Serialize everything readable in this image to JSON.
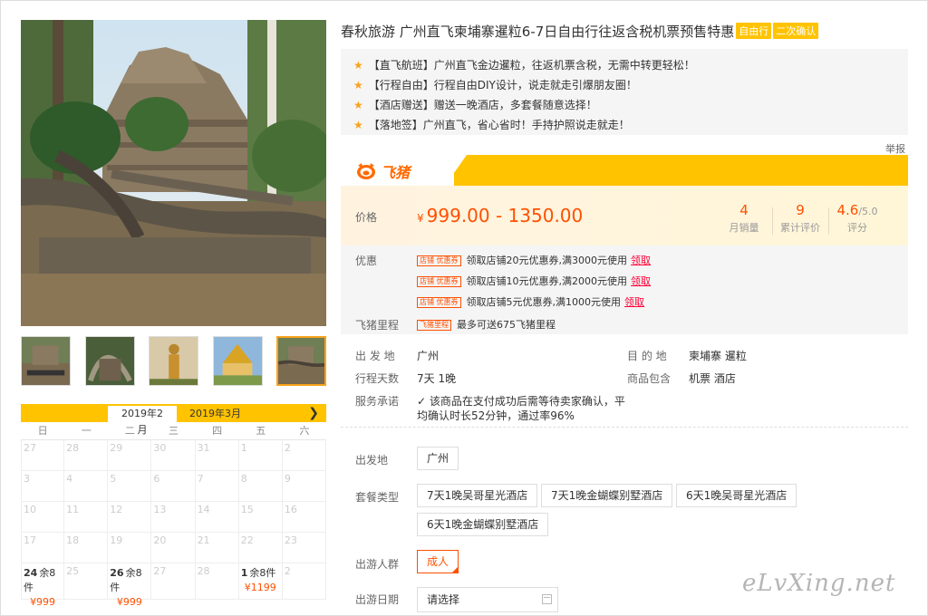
{
  "product": {
    "title": "春秋旅游 广州直飞柬埔寨暹粒6-7日自由行往返含税机票预售特惠",
    "tags": [
      "自由行",
      "二次确认"
    ]
  },
  "features": [
    "【直飞航班】广州直飞金边暹粒，往返机票含税，无需中转更轻松！",
    "【行程自由】行程自由DIY设计，说走就走引爆朋友圈！",
    "【酒店赠送】赠送一晚酒店，多套餐随意选择！",
    "【落地签】广州直飞，省心省时！手持护照说走就走！"
  ],
  "report_label": "举报",
  "brand": {
    "name": "飞猪",
    "color": "#ff6a00",
    "bar_color": "#ffc300"
  },
  "price": {
    "label": "价格",
    "currency": "¥",
    "range": "999.00 - 1350.00",
    "stats": [
      {
        "value": "4",
        "label": "月销量"
      },
      {
        "value": "9",
        "label": "累计评价"
      },
      {
        "value": "4.6",
        "suffix": "/5.0",
        "label": "评分"
      }
    ]
  },
  "promotions": {
    "label": "优惠",
    "badge": "店铺 优惠券",
    "take_label": "领取",
    "coupons": [
      "领取店铺20元优惠券,满3000元使用",
      "领取店铺10元优惠券,满2000元使用",
      "领取店铺5元优惠券,满1000元使用"
    ],
    "miles_label": "飞猪里程",
    "miles_badge": "飞猪里程",
    "miles_text": "最多可送675飞猪里程"
  },
  "info": {
    "origin_label": "出 发 地",
    "origin": "广州",
    "destination_label": "目 的 地",
    "destination": "柬埔寨  暹粒",
    "duration_label": "行程天数",
    "duration": "7天  1晚",
    "includes_label": "商品包含",
    "includes": "机票  酒店",
    "service_label": "服务承诺",
    "service_line1": "该商品在支付成功后需等待卖家确认，平",
    "service_line2": "均确认时长52分钟，通过率96%"
  },
  "options": {
    "departure_label": "出发地",
    "departure_value": "广州",
    "package_label": "套餐类型",
    "packages": [
      "7天1晚吴哥星光酒店",
      "7天1晚金蝴蝶别墅酒店",
      "6天1晚吴哥星光酒店",
      "6天1晚金蝴蝶别墅酒店"
    ],
    "traveler_label": "出游人群",
    "traveler_value": "成人",
    "date_label": "出游日期",
    "date_placeholder": "请选择"
  },
  "calendar": {
    "months": [
      "2019年2月",
      "2019年3月"
    ],
    "weekdays": [
      "日",
      "一",
      "二",
      "三",
      "四",
      "五",
      "六"
    ],
    "rows": [
      [
        "27",
        "28",
        "29",
        "30",
        "31",
        "1",
        "2"
      ],
      [
        "3",
        "4",
        "5",
        "6",
        "7",
        "8",
        "9"
      ],
      [
        "10",
        "11",
        "12",
        "13",
        "14",
        "15",
        "16"
      ],
      [
        "17",
        "18",
        "19",
        "20",
        "21",
        "22",
        "23"
      ]
    ],
    "last_row": [
      {
        "day": "24",
        "stock": "余8件",
        "price": "¥999"
      },
      {
        "day": "25"
      },
      {
        "day": "26",
        "stock": "余8件",
        "price": "¥999"
      },
      {
        "day": "27"
      },
      {
        "day": "28"
      },
      {
        "day": "1",
        "stock": "余8件",
        "price": "¥1199"
      },
      {
        "day": "2"
      }
    ]
  },
  "watermark": "eLvXing.net"
}
